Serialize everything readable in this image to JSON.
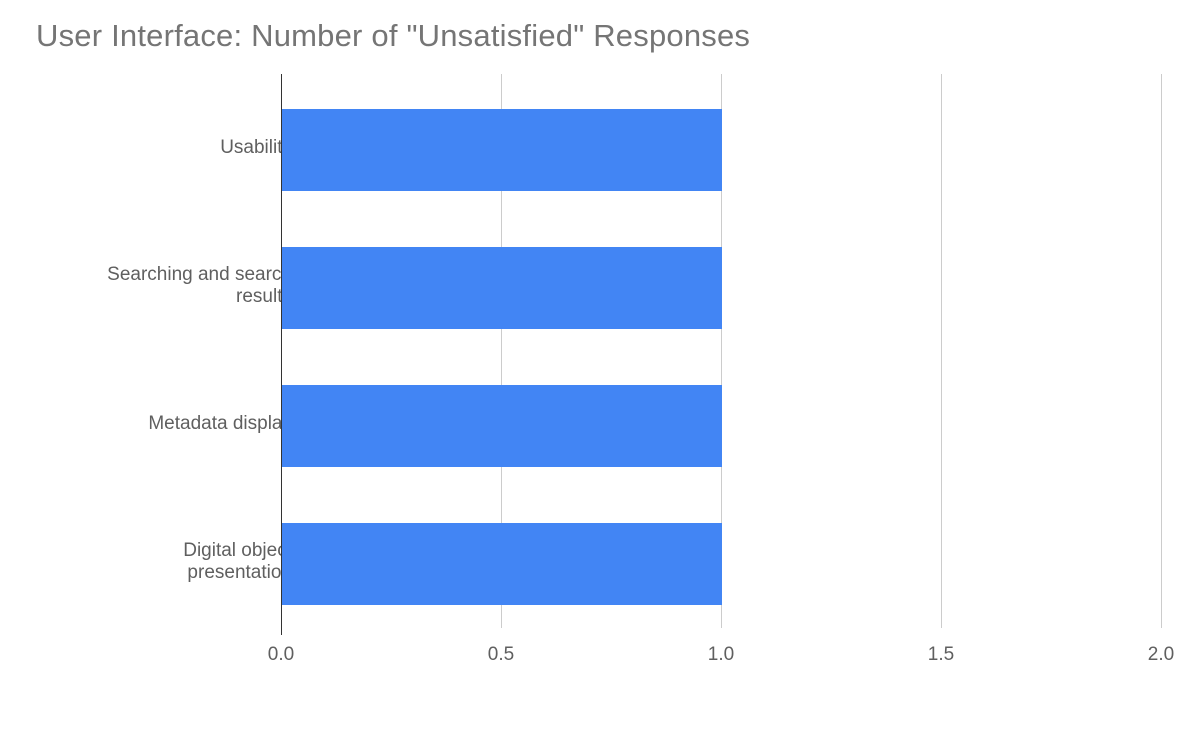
{
  "chart_data": {
    "type": "bar",
    "orientation": "horizontal",
    "title": "User Interface: Number of \"Unsatisfied\" Responses",
    "categories": [
      "Usability",
      "Searching and search results",
      "Metadata display",
      "Digital object presentation"
    ],
    "values": [
      1.0,
      1.0,
      1.0,
      1.0
    ],
    "xlabel": "",
    "ylabel": "",
    "xlim": [
      0.0,
      2.0
    ],
    "x_ticks": [
      0.0,
      0.5,
      1.0,
      1.5,
      2.0
    ],
    "x_tick_labels": [
      "0.0",
      "0.5",
      "1.0",
      "1.5",
      "2.0"
    ],
    "bar_color": "#4285f4",
    "grid_color": "#cccccc",
    "title_color": "#757575"
  }
}
